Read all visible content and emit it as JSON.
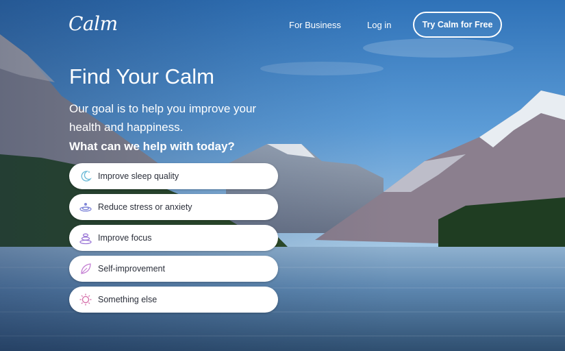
{
  "header": {
    "logo_text": "Calm",
    "nav_for_business": "For Business",
    "nav_login": "Log in",
    "cta_label": "Try Calm for Free"
  },
  "hero": {
    "title": "Find Your Calm",
    "subtitle": "Our goal is to help you improve your health and happiness.",
    "question": "What can we help with today?"
  },
  "options": [
    {
      "label": "Improve sleep quality",
      "icon": "moon-icon",
      "color": "#6fbcd8"
    },
    {
      "label": "Reduce stress or anxiety",
      "icon": "ripple-icon",
      "color": "#7f86d8"
    },
    {
      "label": "Improve focus",
      "icon": "stacked-stones-icon",
      "color": "#9a76d6"
    },
    {
      "label": "Self-improvement",
      "icon": "leaf-icon",
      "color": "#c47fd3"
    },
    {
      "label": "Something else",
      "icon": "sun-icon",
      "color": "#d469a6"
    }
  ],
  "colors": {
    "sky": "#3f86c8",
    "water": "#5d87b0",
    "button_text": "#2b2f3a"
  }
}
